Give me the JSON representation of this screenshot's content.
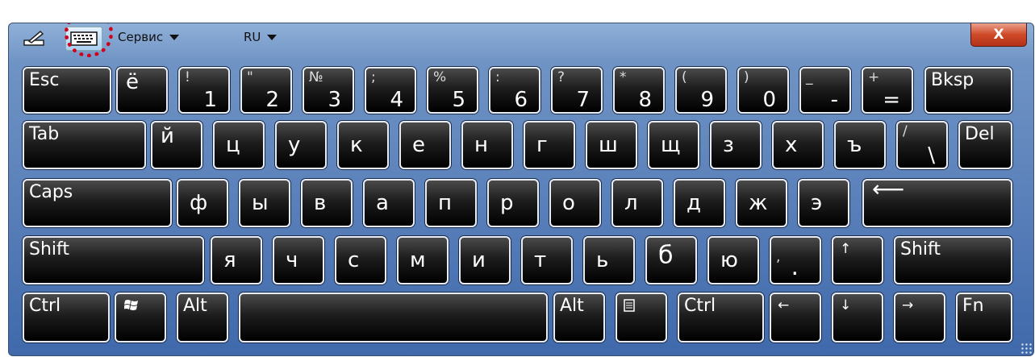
{
  "toolbar": {
    "pen_icon": "pen-tablet-icon",
    "keyboard_icon": "keyboard-icon",
    "service_label": "Сервис",
    "lang_label": "RU",
    "close_label": "X"
  },
  "rows": {
    "r1": {
      "esc": "Esc",
      "yo": "ё",
      "d1": {
        "sup": "!",
        "main": "1"
      },
      "d2": {
        "sup": "\"",
        "main": "2"
      },
      "d3": {
        "sup": "№",
        "main": "3"
      },
      "d4": {
        "sup": ";",
        "main": "4"
      },
      "d5": {
        "sup": "%",
        "main": "5"
      },
      "d6": {
        "sup": ":",
        "main": "6"
      },
      "d7": {
        "sup": "?",
        "main": "7"
      },
      "d8": {
        "sup": "*",
        "main": "8"
      },
      "d9": {
        "sup": "(",
        "main": "9"
      },
      "d0": {
        "sup": ")",
        "main": "0"
      },
      "minus": {
        "sup": "_",
        "main": "-"
      },
      "equal": {
        "sup": "+",
        "main": "="
      },
      "bksp": "Bksp"
    },
    "r2": {
      "tab": "Tab",
      "letters": [
        "й",
        "ц",
        "у",
        "к",
        "е",
        "н",
        "г",
        "ш",
        "щ",
        "з",
        "х",
        "ъ"
      ],
      "slash": {
        "sup": "/",
        "main": "\\"
      },
      "del": "Del"
    },
    "r3": {
      "caps": "Caps",
      "letters": [
        "ф",
        "ы",
        "в",
        "а",
        "п",
        "р",
        "о",
        "л",
        "д",
        "ж",
        "э"
      ],
      "enter": "⟵"
    },
    "r4": {
      "shift_left": "Shift",
      "letters": [
        "я",
        "ч",
        "с",
        "м",
        "и",
        "т",
        "ь",
        "б",
        "ю"
      ],
      "comma": {
        "sup": ",",
        "main": "."
      },
      "up": "↑",
      "shift_right": "Shift"
    },
    "r5": {
      "ctrl_left": "Ctrl",
      "win": "windows-logo-icon",
      "alt_left": "Alt",
      "alt_right": "Alt",
      "menu": "context-menu-icon",
      "ctrl_right": "Ctrl",
      "left": "←",
      "down": "↓",
      "right": "→",
      "fn": "Fn"
    }
  }
}
